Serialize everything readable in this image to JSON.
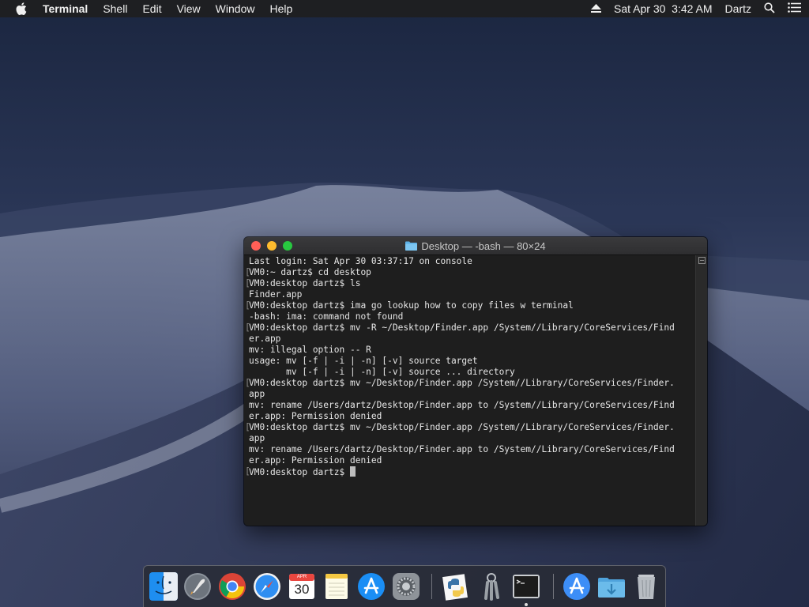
{
  "menubar": {
    "app_name": "Terminal",
    "menus": [
      "Shell",
      "Edit",
      "View",
      "Window",
      "Help"
    ],
    "datetime": "Sat Apr 30  3:42 AM",
    "user": "Dartz"
  },
  "terminal": {
    "title": "Desktop — -bash — 80×24",
    "lines": [
      "Last login: Sat Apr 30 03:37:17 on console",
      "VM0:~ dartz$ cd desktop",
      "VM0:desktop dartz$ ls",
      "Finder.app",
      "VM0:desktop dartz$ ima go lookup how to copy files w terminal",
      "-bash: ima: command not found",
      "VM0:desktop dartz$ mv -R ~/Desktop/Finder.app /System//Library/CoreServices/Find",
      "er.app",
      "mv: illegal option -- R",
      "usage: mv [-f | -i | -n] [-v] source target",
      "       mv [-f | -i | -n] [-v] source ... directory",
      "VM0:desktop dartz$ mv ~/Desktop/Finder.app /System//Library/CoreServices/Finder.",
      "app",
      "mv: rename /Users/dartz/Desktop/Finder.app to /System//Library/CoreServices/Find",
      "er.app: Permission denied",
      "VM0:desktop dartz$ mv ~/Desktop/Finder.app /System//Library/CoreServices/Finder.",
      "app",
      "mv: rename /Users/dartz/Desktop/Finder.app to /System//Library/CoreServices/Find",
      "er.app: Permission denied",
      "VM0:desktop dartz$ "
    ]
  },
  "dock": {
    "calendar_month": "APR",
    "calendar_day": "30",
    "items": [
      "Finder",
      "Launchpad",
      "Chrome",
      "Safari",
      "Calendar",
      "Notes",
      "App Store",
      "System Preferences",
      "Python Launcher",
      "Keychain Access",
      "Terminal",
      "Applications",
      "Downloads",
      "Trash"
    ]
  },
  "colors": {
    "close": "#ff5f57",
    "minimize": "#febc2e",
    "maximize": "#28c840",
    "terminal_bg": "#1e1e1e",
    "terminal_text": "#e6e6e6"
  }
}
